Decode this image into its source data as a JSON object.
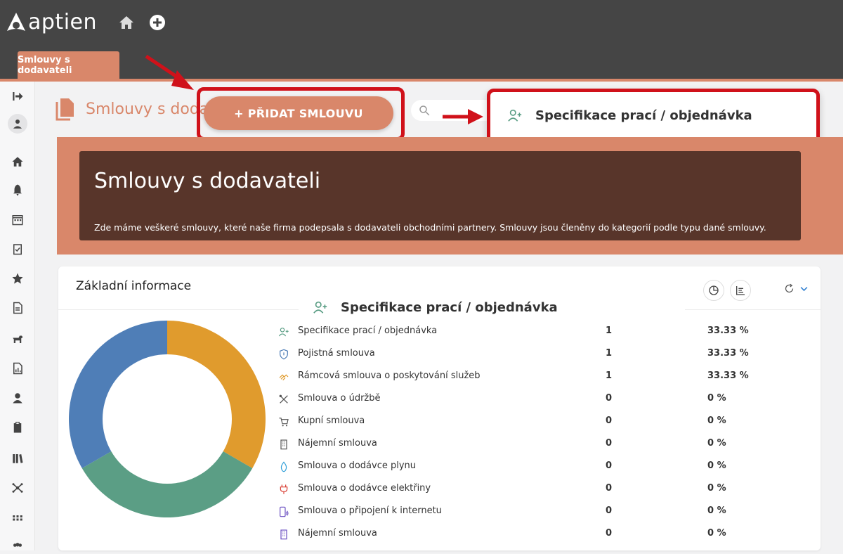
{
  "app": {
    "logo_text": "aptien"
  },
  "tabs": [
    {
      "label": "Smlouvy s dodavateli"
    }
  ],
  "page": {
    "title": "Smlouvy s dodavateli",
    "add_button": "+ PŘIDAT SMLOUVU"
  },
  "dropdown": {
    "item_label": "Specifikace prací / objednávka"
  },
  "banner": {
    "title": "Smlouvy s dodavateli",
    "description": "Zde máme veškeré smlouvy, které naše firma podepsala s dodavateli obchodními partnery. Smlouvy jsou členěny do kategorií podle typu dané smlouvy."
  },
  "card": {
    "title": "Základní informace",
    "chart_heading": "Specifikace prací / objednávka"
  },
  "colors": {
    "accent": "#d9876a",
    "banner_dark": "#58352a",
    "highlight": "#d0111a"
  },
  "chart_data": {
    "type": "pie",
    "categories": [
      "Specifikace prací / objednávka",
      "Pojistná smlouva",
      "Rámcová smlouva o poskytování služeb",
      "Smlouva o údržbě",
      "Kupní smlouva",
      "Nájemní smlouva",
      "Smlouva o dodávce plynu",
      "Smlouva o dodávce elektřiny",
      "Smlouva o připojení k internetu",
      "Nájemní smlouva"
    ],
    "values": [
      1,
      1,
      1,
      0,
      0,
      0,
      0,
      0,
      0,
      0
    ],
    "percentages": [
      "33.33 %",
      "33.33 %",
      "33.33 %",
      "0 %",
      "0 %",
      "0 %",
      "0 %",
      "0 %",
      "0 %",
      "0 %"
    ],
    "colors": [
      "#5b9e85",
      "#4f7eb7",
      "#e09b2d",
      "#888888",
      "#888888",
      "#888888",
      "#888888",
      "#888888",
      "#888888",
      "#888888"
    ],
    "icons": [
      "user-plus-icon",
      "shield-icon",
      "handshake-icon",
      "tools-icon",
      "cart-icon",
      "building-icon",
      "flame-icon",
      "plug-icon",
      "phone-wifi-icon",
      "building-icon"
    ]
  }
}
